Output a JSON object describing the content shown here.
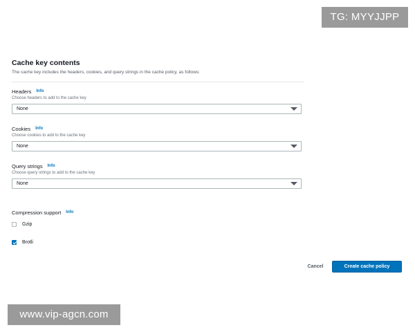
{
  "watermarks": {
    "top": "TG: MYYJJPP",
    "bottom": "www.vip-agcn.com"
  },
  "cache_key": {
    "title": "Cache key contents",
    "description": "The cache key includes the headers, cookies, and query strings in the cache policy, as follows:"
  },
  "headers": {
    "label": "Headers",
    "info": "Info",
    "description": "Choose headers to add to the cache key",
    "value": "None"
  },
  "cookies": {
    "label": "Cookies",
    "info": "Info",
    "description": "Choose cookies to add to the cache key",
    "value": "None"
  },
  "query_strings": {
    "label": "Query strings",
    "info": "Info",
    "description": "Choose query strings to add to the cache key",
    "value": "None"
  },
  "compression": {
    "label": "Compression support",
    "info": "Info",
    "options": [
      {
        "label": "Gzip",
        "checked": false
      },
      {
        "label": "Brotli",
        "checked": true
      }
    ]
  },
  "actions": {
    "cancel": "Cancel",
    "create": "Create cache policy"
  },
  "colors": {
    "primary": "#0073bb",
    "link": "#0073bb",
    "text": "#16191f",
    "muted": "#687078"
  },
  "icons": {
    "select_caret": "caret-down-icon",
    "checkbox_check": "check-icon"
  }
}
